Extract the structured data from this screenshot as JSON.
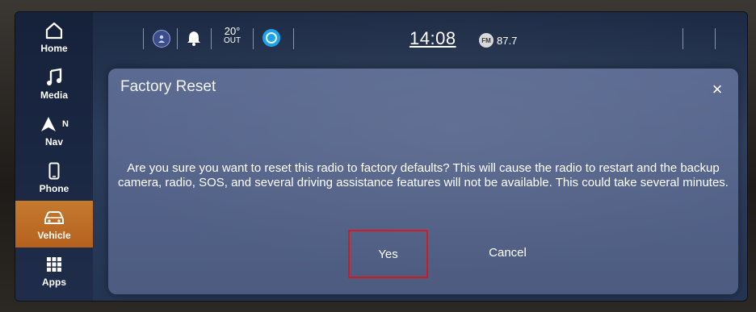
{
  "rail": {
    "items": [
      {
        "label": "Home",
        "icon": "home-icon"
      },
      {
        "label": "Media",
        "icon": "music-note-icon"
      },
      {
        "label": "Nav",
        "icon": "navigation-arrow-icon",
        "compass": "N"
      },
      {
        "label": "Phone",
        "icon": "phone-icon"
      },
      {
        "label": "Vehicle",
        "icon": "car-icon",
        "active": true
      },
      {
        "label": "Apps",
        "icon": "apps-grid-icon"
      }
    ]
  },
  "status_bar": {
    "temperature": "20°",
    "temperature_label": "OUT",
    "time": "14:08",
    "radio_band": "FM",
    "radio_frequency": "87.7"
  },
  "dialog": {
    "title": "Factory Reset",
    "close_label": "×",
    "message": "Are you sure you want to reset this radio to factory defaults? This will cause the radio to restart and the backup camera, radio, SOS, and several driving assistance features will not be available. This could take several minutes.",
    "yes_label": "Yes",
    "cancel_label": "Cancel"
  },
  "colors": {
    "active_rail": "#c57a2f",
    "highlight_box": "#d8161c",
    "dialog_bg": "#5f6e96"
  }
}
